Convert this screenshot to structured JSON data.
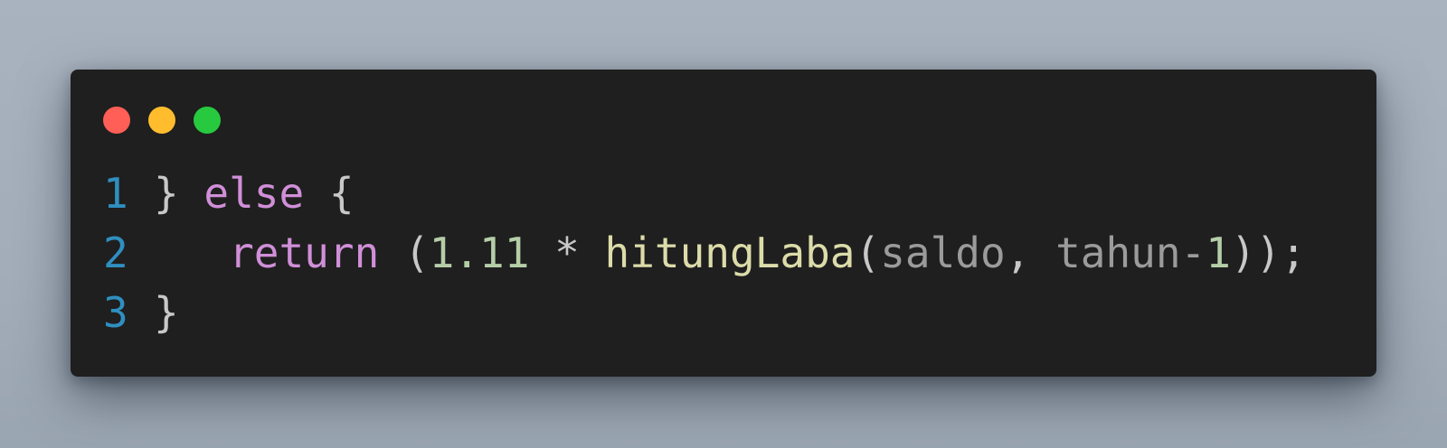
{
  "window": {
    "controls": [
      {
        "name": "close",
        "color": "#ff5f56"
      },
      {
        "name": "minimize",
        "color": "#ffbd2e"
      },
      {
        "name": "maximize",
        "color": "#27c93f"
      }
    ]
  },
  "code": {
    "lines": [
      {
        "number": "1",
        "tokens": [
          {
            "text": "} ",
            "kind": "punct"
          },
          {
            "text": "else",
            "kind": "keyword"
          },
          {
            "text": " {",
            "kind": "punct"
          }
        ]
      },
      {
        "number": "2",
        "tokens": [
          {
            "text": "   ",
            "kind": "punct"
          },
          {
            "text": "return",
            "kind": "keyword"
          },
          {
            "text": " (",
            "kind": "punct"
          },
          {
            "text": "1.11",
            "kind": "number"
          },
          {
            "text": " * ",
            "kind": "punct"
          },
          {
            "text": "hitungLaba",
            "kind": "func"
          },
          {
            "text": "(",
            "kind": "punct"
          },
          {
            "text": "saldo",
            "kind": "param"
          },
          {
            "text": ", ",
            "kind": "punct"
          },
          {
            "text": "tahun-",
            "kind": "param"
          },
          {
            "text": "1",
            "kind": "number"
          },
          {
            "text": "));",
            "kind": "punct"
          }
        ]
      },
      {
        "number": "3",
        "tokens": [
          {
            "text": "}",
            "kind": "punct"
          }
        ]
      }
    ]
  },
  "colors": {
    "background": "#1f1f1f",
    "line_number": "#2f8fc0",
    "keyword": "#d08fd8",
    "number": "#b5cea8",
    "function": "#dcdcaa",
    "parameter": "#9b9b9b",
    "punctuation": "#c8c8c8"
  }
}
